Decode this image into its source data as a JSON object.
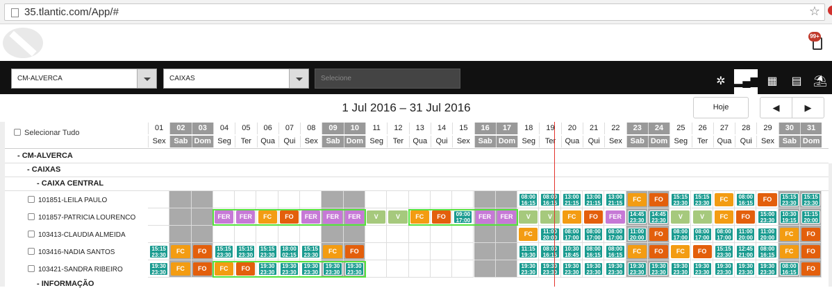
{
  "browser": {
    "url": "35.tlantic.com/App/#"
  },
  "notifications": {
    "badge": "99+"
  },
  "toolbar": {
    "store_select": "CM-ALVERCA",
    "section_select": "CAIXAS",
    "third_select_placeholder": "Selecione"
  },
  "nav": {
    "title": "1 Jul 2016 – 31 Jul 2016",
    "today_label": "Hoje",
    "prev": "◀",
    "next": "▶"
  },
  "grid": {
    "select_all": "Selecionar Tudo",
    "days": [
      "01",
      "02",
      "03",
      "04",
      "05",
      "06",
      "07",
      "08",
      "09",
      "10",
      "11",
      "12",
      "13",
      "14",
      "15",
      "16",
      "17",
      "18",
      "19",
      "20",
      "21",
      "22",
      "23",
      "24",
      "25",
      "26",
      "27",
      "28",
      "29",
      "30",
      "31"
    ],
    "weekday_names": [
      "Sex",
      "Sab",
      "Dom",
      "Seg",
      "Ter",
      "Qua",
      "Qui",
      "Sex",
      "Sab",
      "Dom",
      "Seg",
      "Ter",
      "Qua",
      "Qui",
      "Sex",
      "Sab",
      "Dom",
      "Seg",
      "Ter",
      "Qua",
      "Qui",
      "Sex",
      "Sab",
      "Dom",
      "Seg",
      "Ter",
      "Qua",
      "Qui",
      "Sex",
      "Sab",
      "Dom"
    ],
    "weekends": [
      2,
      3,
      9,
      10,
      16,
      17,
      23,
      24,
      30,
      31
    ],
    "groups": [
      {
        "label": "- CM-ALVERCA"
      },
      {
        "label": "- CAIXAS"
      },
      {
        "label": "- CAIXA CENTRAL"
      },
      {
        "label": "- INFORMAÇÃO"
      }
    ],
    "employees": [
      {
        "name": "101851-LEILA PAULO",
        "shifts": {
          "18": "08:00|16:15",
          "19": "08:00|16:15",
          "20": "13:00|21:15",
          "21": "13:00|21:15",
          "22": "13:00|21:15",
          "23": "FC",
          "24": "FO",
          "25": "15:15|23:30",
          "26": "15:15|23:30",
          "27": "FC",
          "28": "08:00|16:15",
          "29": "FO",
          "30": "15:15|23:30",
          "31": "15:15|23:30"
        }
      },
      {
        "name": "101857-PATRICIA LOURENCO",
        "shifts": {
          "04": "FER",
          "05": "FER",
          "06": "FC",
          "07": "FO",
          "08": "FER",
          "09": "FER",
          "10": "FER",
          "11": "V",
          "12": "V",
          "13": "FC",
          "14": "FO",
          "15": "09:00|17:00",
          "16": "FER",
          "17": "FER",
          "18": "V",
          "19": "V",
          "20": "FC",
          "21": "FO",
          "22": "FER",
          "23": "14:45|23:30",
          "24": "14:45|23:30",
          "25": "V",
          "26": "V",
          "27": "FC",
          "28": "FO",
          "29": "15:00|23:30",
          "30": "10:30|19:15",
          "31": "11:15|20:00"
        }
      },
      {
        "name": "103413-CLAUDIA ALMEIDA",
        "shifts": {
          "18": "FC",
          "19": "11:00|20:00",
          "20": "08:00|17:00",
          "21": "08:00|17:00",
          "22": "08:00|17:00",
          "23": "11:00|20:00",
          "24": "FO",
          "25": "08:00|17:00",
          "26": "08:00|17:00",
          "27": "08:00|17:00",
          "28": "11:00|20:00",
          "29": "11:00|20:00",
          "30": "FC",
          "31": "FO"
        }
      },
      {
        "name": "103416-NADIA SANTOS",
        "shifts": {
          "01": "15:15|23:30",
          "02": "FC",
          "03": "FO",
          "04": "15:15|23:30",
          "05": "15:15|23:30",
          "06": "15:15|23:30",
          "07": "18:00|02:15",
          "08": "15:15|23:30",
          "09": "FC",
          "10": "FO",
          "18": "11:15|19:30",
          "19": "08:00|16:15",
          "20": "10:30|18:45",
          "21": "08:00|16:15",
          "22": "08:00|16:15",
          "23": "FC",
          "24": "FO",
          "25": "FC",
          "26": "FO",
          "27": "15:15|23:30",
          "28": "12:45|21:00",
          "29": "08:00|16:15",
          "30": "FC",
          "31": "FO"
        }
      },
      {
        "name": "103421-SANDRA RIBEIRO",
        "shifts": {
          "01": "19:30|23:30",
          "02": "FC",
          "03": "FO",
          "04": "FC",
          "05": "FO",
          "06": "19:30|23:30",
          "07": "19:30|23:30",
          "08": "19:30|23:30",
          "09": "19:30|23:30",
          "10": "19:30|23:30",
          "18": "19:30|23:30",
          "19": "19:30|23:30",
          "20": "19:30|23:30",
          "21": "19:30|23:30",
          "22": "19:30|23:30",
          "23": "19:30|23:30",
          "24": "19:30|23:30",
          "25": "19:30|23:30",
          "26": "19:30|23:30",
          "27": "19:30|23:30",
          "28": "19:30|23:30",
          "29": "19:30|23:30",
          "30": "08:00|16:15",
          "31": "FO"
        }
      }
    ]
  },
  "colors": {
    "turno": "#1a9b90",
    "fc": "#f39c12",
    "fo": "#e35f0c",
    "fer": "#c679d6",
    "v": "#a6c97d",
    "highlight": "#54e13b",
    "today": "#e3322b"
  }
}
